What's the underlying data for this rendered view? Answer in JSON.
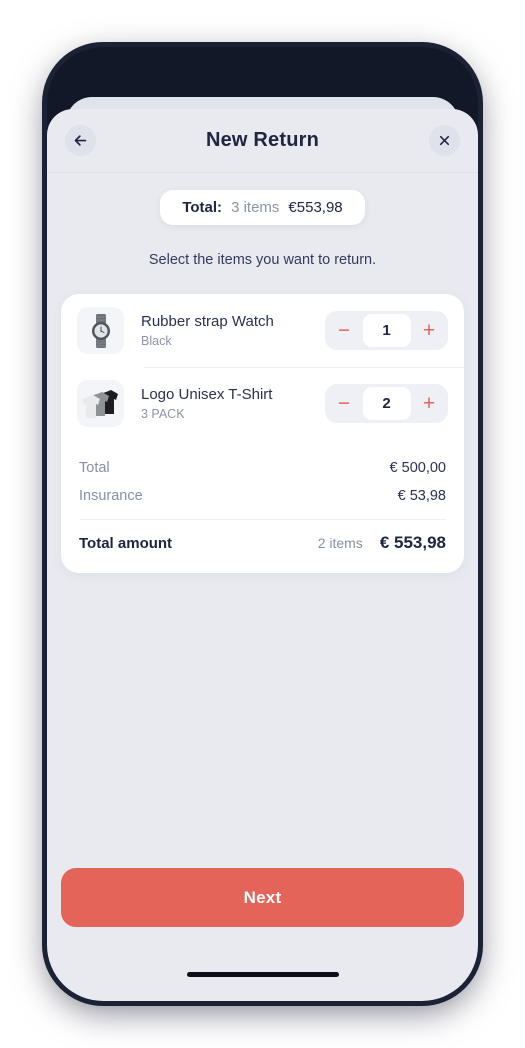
{
  "header": {
    "title": "New Return",
    "back_icon": "arrow-left-icon",
    "close_icon": "close-icon"
  },
  "total_pill": {
    "label": "Total:",
    "items": "3 items",
    "amount": "€553,98"
  },
  "instruction": "Select the items you want to return.",
  "items": [
    {
      "title": "Rubber strap Watch",
      "variant": "Black",
      "thumb_icon": "watch-thumbnail",
      "quantity": "1",
      "minus_label": "−",
      "plus_label": "+"
    },
    {
      "title": "Logo Unisex T-Shirt",
      "variant": "3 PACK",
      "thumb_icon": "tshirt-thumbnail",
      "quantity": "2",
      "minus_label": "−",
      "plus_label": "+"
    }
  ],
  "summary": {
    "rows": [
      {
        "label": "Total",
        "value": "€ 500,00"
      },
      {
        "label": "Insurance",
        "value": "€ 53,98"
      }
    ],
    "total_label": "Total amount",
    "total_items": "2 items",
    "total_value": "€ 553,98"
  },
  "next_button": "Next",
  "colors": {
    "accent": "#e4645a",
    "ink": "#1f2440",
    "muted": "#8d93a8",
    "screen_bg": "#e8eaf0",
    "frame": "#121827"
  }
}
